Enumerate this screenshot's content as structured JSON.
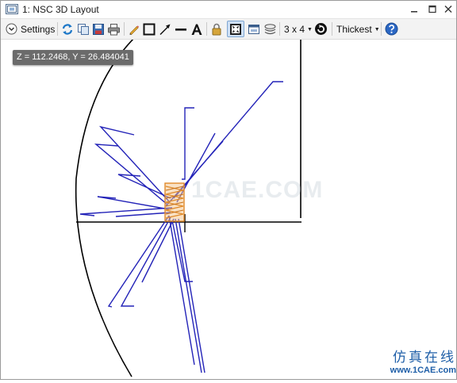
{
  "window": {
    "title": "1: NSC 3D Layout"
  },
  "toolbar": {
    "settings_label": "Settings",
    "grid_size_label": "3 x 4",
    "line_thickness_label": "Thickest"
  },
  "plot": {
    "coordinate_readout": "Z = 112.2468, Y = 26.484041",
    "watermark": "1CAE.COM"
  },
  "branding": {
    "site_name_cn": "仿真在线",
    "site_url": "www.1CAE.com"
  },
  "colors": {
    "ray_color": "#2323b8",
    "source_color": "#e08a2a",
    "frame_color": "#000000",
    "tooltip_bg": "#6b6b6b"
  }
}
